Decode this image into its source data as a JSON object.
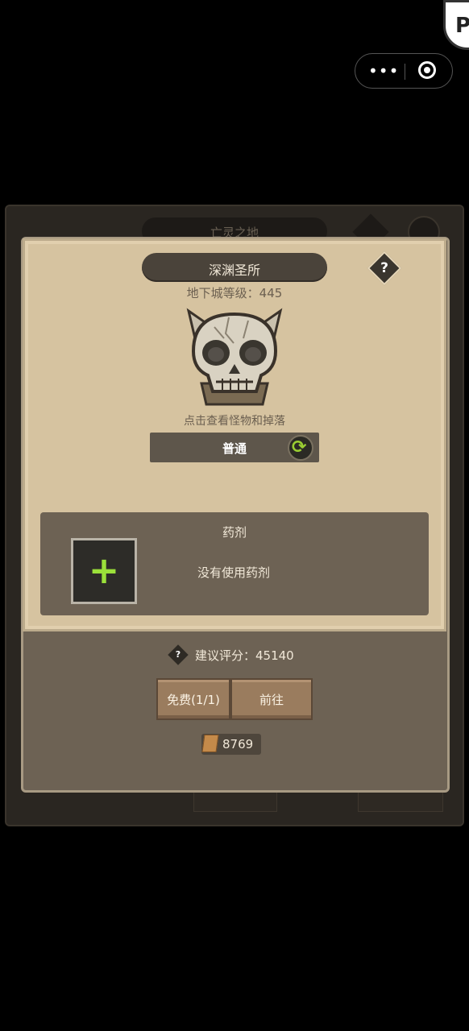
{
  "system": {
    "capsule_more_icon": "more-dots-icon",
    "capsule_close_icon": "target-close-icon"
  },
  "background": {
    "title": "亡灵之地"
  },
  "dungeon": {
    "title": "深渊圣所",
    "level_text": "地下城等级：445",
    "hint": "点击查看怪物和掉落",
    "mode": "普通",
    "help_symbol": "?"
  },
  "potion": {
    "title": "药剂",
    "empty_text": "没有使用药剂",
    "add_symbol": "+"
  },
  "score": {
    "icon": "?",
    "text": "建议评分：45140"
  },
  "buttons": {
    "free": "免费(1/1)",
    "go": "前往"
  },
  "currency": {
    "value": "8769"
  },
  "colors": {
    "parchment": "#d6c3a0",
    "panel": "#6d6254",
    "accent_green": "#9be03a",
    "wood": "#9a7c5e"
  }
}
